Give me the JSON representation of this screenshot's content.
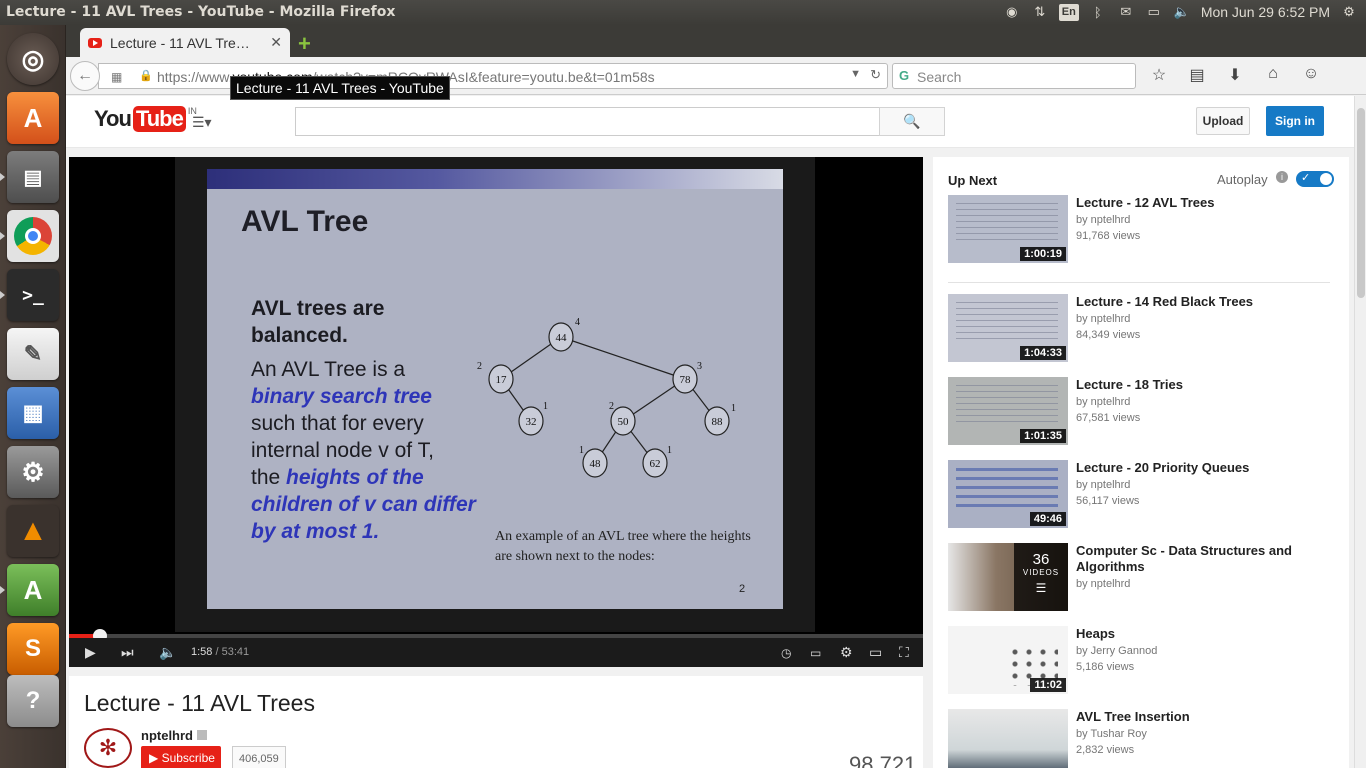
{
  "os": {
    "window_title": "Lecture - 11 AVL Trees - YouTube - Mozilla Firefox",
    "keyboard_layout": "En",
    "clock": "Mon Jun 29  6:52 PM"
  },
  "browser": {
    "tab_title": "Lecture - 11 AVL Tre…",
    "url_prefix": "https://www.",
    "url_host": "youtube.com",
    "url_rest": "/watch?v=mRCQvRWAsI&feature=youtu.be&t=01m58s",
    "search_placeholder": "Search",
    "tooltip": "Lecture - 11 AVL Trees - YouTube"
  },
  "youtube": {
    "logo_you": "You",
    "logo_tube": "Tube",
    "logo_region": "IN",
    "upload_label": "Upload",
    "signin_label": "Sign in"
  },
  "slide": {
    "heading": "AVL Tree",
    "bullet1_line1": "AVL trees are",
    "bullet1_line2": "balanced.",
    "bullet2_line1": "An AVL Tree is a",
    "bullet2_em1": "binary search tree",
    "bullet2_line3": "such that for every",
    "bullet2_line4": "internal node v of T,",
    "bullet2_line5a": "the ",
    "bullet2_em2": "heights of the",
    "bullet2_em3": "children of v can differ",
    "bullet2_em4": "by at most 1.",
    "caption": "An example of an AVL tree where the heights are shown next to the nodes:",
    "page_no": "2",
    "nodes": [
      "44",
      "17",
      "78",
      "32",
      "50",
      "88",
      "48",
      "62"
    ],
    "heights": [
      "4",
      "2",
      "3",
      "1",
      "2",
      "1",
      "1",
      "1"
    ]
  },
  "player": {
    "progress": 0.0368,
    "current_time": "1:58",
    "duration": "53:41"
  },
  "video": {
    "title": "Lecture - 11 AVL Trees",
    "channel": "nptelhrd",
    "subscribe_label": "Subscribe",
    "subscriber_count": "406,059",
    "view_count_partial": "98,721"
  },
  "sidebar": {
    "up_next_label": "Up Next",
    "autoplay_label": "Autoplay",
    "items": [
      {
        "title": "Lecture - 12 AVL Trees",
        "by": "by nptelhrd",
        "views": "91,768 views",
        "duration": "1:00:19"
      },
      {
        "title": "Lecture - 14 Red Black Trees",
        "by": "by nptelhrd",
        "views": "84,349 views",
        "duration": "1:04:33"
      },
      {
        "title": "Lecture - 18 Tries",
        "by": "by nptelhrd",
        "views": "67,581 views",
        "duration": "1:01:35"
      },
      {
        "title": "Lecture - 20 Priority Queues",
        "by": "by nptelhrd",
        "views": "56,117 views",
        "duration": "49:46"
      },
      {
        "title": "Computer Sc - Data Structures and Algorithms",
        "by": "by nptelhrd",
        "playlist_count": "36",
        "playlist_label": "VIDEOS"
      },
      {
        "title": "Heaps",
        "by": "by Jerry Gannod",
        "views": "5,186 views",
        "duration": "11:02"
      },
      {
        "title": "AVL Tree Insertion",
        "by": "by Tushar Roy",
        "views": "2,832 views"
      }
    ]
  },
  "colors": {
    "brand_red": "#e62117",
    "signin_blue": "#167ac6",
    "panel_dark": "#3c3b37"
  }
}
